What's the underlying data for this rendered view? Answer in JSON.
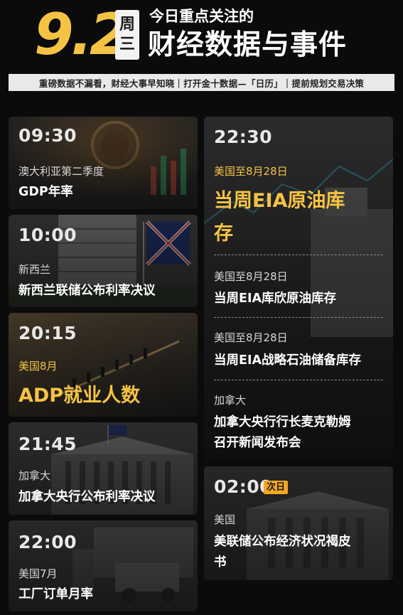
{
  "header": {
    "date": "9.2",
    "weekday": [
      "周",
      "三"
    ],
    "subtitle": "今日重点关注的",
    "title": "财经数据与事件"
  },
  "tagline": "重磅数据不漏看，财经大事早知晓｜打开金十数据—「日历」｜提前规划交易决策",
  "left_cards": [
    {
      "time": "09:30",
      "region": "澳大利亚第二季度",
      "event": "GDP年率"
    },
    {
      "time": "10:00",
      "region": "新西兰",
      "event": "新西兰联储公布利率决议"
    },
    {
      "time": "20:15",
      "region": "美国8月",
      "event": "ADP就业人数"
    },
    {
      "time": "21:45",
      "region": "加拿大",
      "event": "加拿大央行公布利率决议"
    },
    {
      "time": "22:00",
      "region": "美国7月",
      "event": "工厂订单月率"
    }
  ],
  "right_card_1": {
    "time": "22:30",
    "items": [
      {
        "region": "美国至8月28日",
        "event_line1": "当周EIA原油库",
        "event_line2": "存"
      },
      {
        "region": "美国至8月28日",
        "event": "当周EIA库欣原油库存"
      },
      {
        "region": "美国至8月28日",
        "event": "当周EIA战略石油储备库存"
      },
      {
        "region": "加拿大",
        "event_line1": "加拿大央行行长麦克勒姆",
        "event_line2": "召开新闻发布会"
      }
    ]
  },
  "right_card_2": {
    "time": "02:00",
    "badge": "次日",
    "region": "美国",
    "event_line1": "美联储公布经济状况褐皮",
    "event_line2": "书"
  },
  "colors": {
    "gold": "#f5c344",
    "badge": "#f5a623",
    "background": "#0b0b0c"
  }
}
